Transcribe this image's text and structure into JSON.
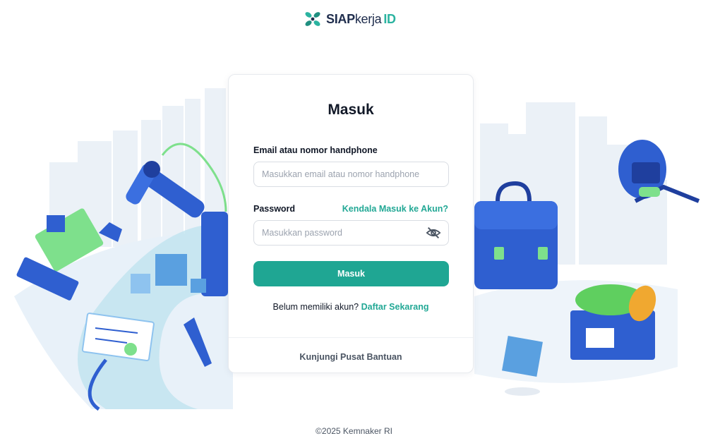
{
  "brand": {
    "siap": "SIAP",
    "kerja": "kerja",
    "id": "ID"
  },
  "card": {
    "title": "Masuk",
    "email": {
      "label": "Email atau nomor handphone",
      "placeholder": "Masukkan email atau nomor handphone",
      "value": ""
    },
    "password": {
      "label": "Password",
      "placeholder": "Masukkan password",
      "value": "",
      "trouble_link": "Kendala Masuk ke Akun?"
    },
    "submit_label": "Masuk",
    "register_prompt": "Belum memiliki akun?",
    "register_link": "Daftar Sekarang",
    "help_link": "Kunjungi Pusat Bantuan"
  },
  "footer": {
    "copyright": "©2025 Kemnaker RI"
  },
  "colors": {
    "accent": "#1fa693",
    "brand_navy": "#1f2d4d",
    "illustration_blue": "#2f5fd0"
  },
  "icons": {
    "logo": "siapkerja-logo-icon",
    "password_toggle": "eye-off-icon"
  }
}
